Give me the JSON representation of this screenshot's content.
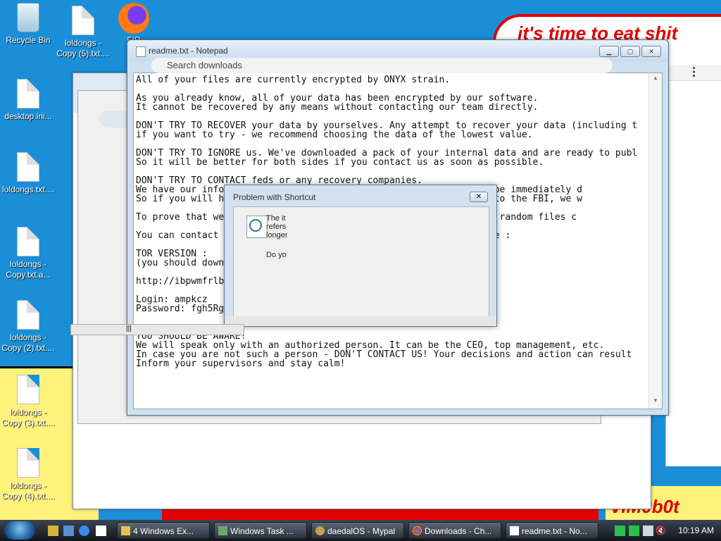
{
  "wallpaper": {
    "banner_text": "it's time to eat shit",
    "signature": "ViM0b0t"
  },
  "desktop_icons": [
    {
      "label": "Recycle Bin"
    },
    {
      "label": "loldongs - Copy (5).txt...."
    },
    {
      "label": "FIR"
    },
    {
      "label": "desktop.ini..."
    },
    {
      "label": "loldongs.txt...."
    },
    {
      "label": "loldongs - Copy.txt.a..."
    },
    {
      "label": "loldongs - Copy (2).txt...."
    },
    {
      "label": "loldongs - Copy (3).txt...."
    },
    {
      "label": "loldongs - Copy (4).txt...."
    }
  ],
  "chrome": {
    "search_placeholder": "Search downloads"
  },
  "notepad": {
    "title": "readme.txt - Notepad",
    "content": "All of your files are currently encrypted by ONYX strain.\n\nAs you already know, all of your data has been encrypted by our software.\nIt cannot be recovered by any means without contacting our team directly.\n\nDON'T TRY TO RECOVER your data by yourselves. Any attempt to recover your data (including t\nif you want to try - we recommend choosing the data of the lowest value.\n\nDON'T TRY TO IGNORE us. We've downloaded a pack of your internal data and are ready to publ\nSo it will be better for both sides if you contact us as soon as possible.\n\nDON'T TRY TO CONTACT feds or any recovery companies.\nWe have our info                                      aints will be immediately d\nSo if you will h                                      d requests to the FBI, we w\n\nTo prove that we                                      decrypt two random files c\n\nYou can contact                                     gh our website :\n\nTOR VERSION :\n(you should down                                     oject.org)\n\nhttp://ibpwmfrlb                                    onion\n\nLogin: ampkcz\nPassword: fgh5Rg\n\n\nYOU SHOULD BE AWARE!\nWe will speak only with an authorized person. It can be the CEO, top management, etc.\nIn case you are not such a person - DON'T CONTACT US! Your decisions and action can result\nInform your supervisors and stay calm!"
  },
  "dialog": {
    "title": "Problem with Shortcut",
    "message": "The it\nrefers\nlonger",
    "question": "Do yo"
  },
  "taskbar": {
    "buttons": [
      {
        "label": "4 Windows Ex..."
      },
      {
        "label": "Windows Task ..."
      },
      {
        "label": "daedalOS - Mypal"
      },
      {
        "label": "Downloads - Ch..."
      },
      {
        "label": "readme.txt - No..."
      }
    ],
    "clock": "10:19 AM"
  }
}
